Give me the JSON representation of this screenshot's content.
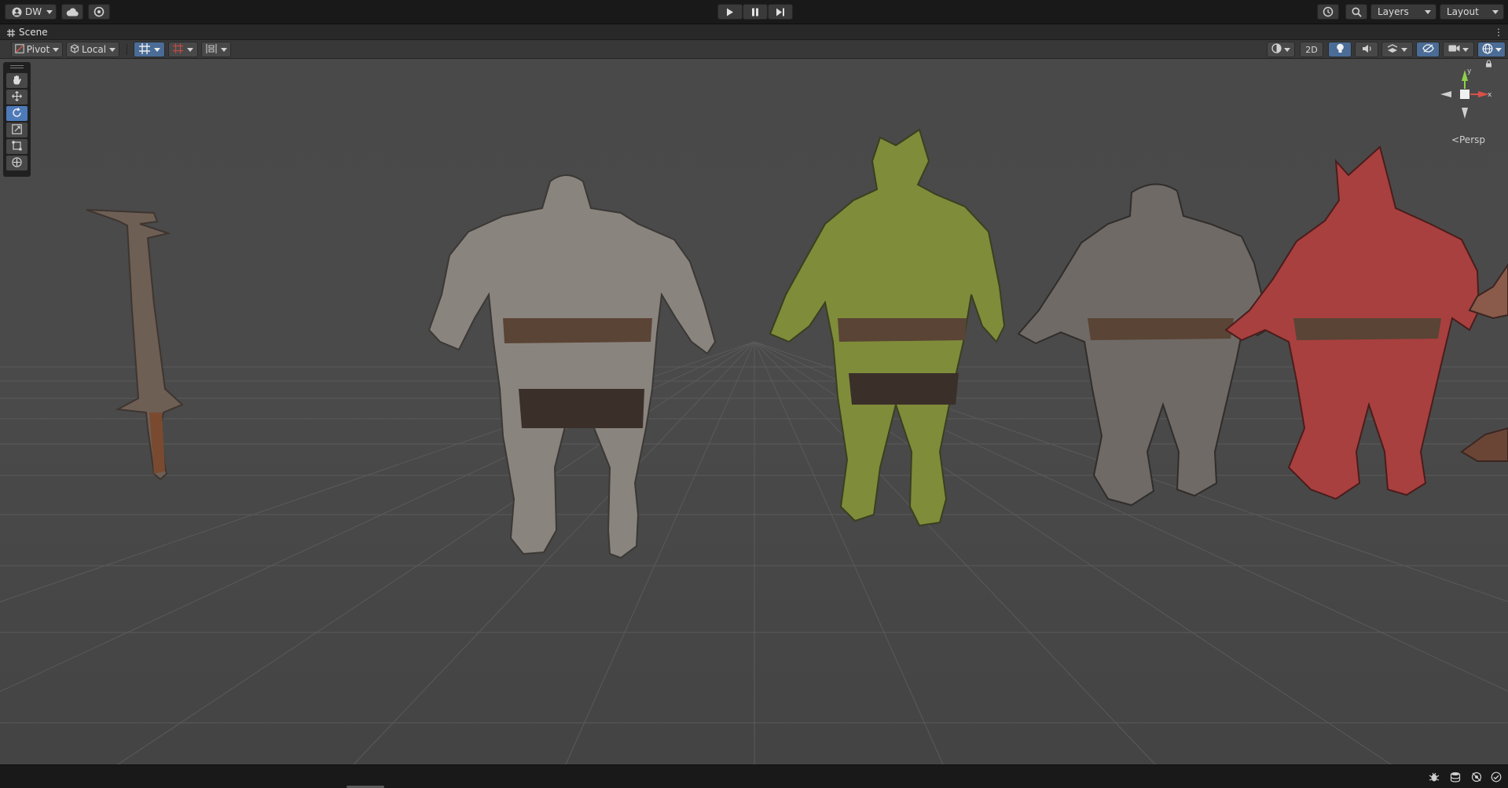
{
  "toolbar": {
    "account_label": "DW",
    "layers_label": "Layers",
    "layout_label": "Layout",
    "icons": [
      "account-icon",
      "cloud-icon",
      "collab-icon",
      "play-icon",
      "pause-icon",
      "step-icon",
      "history-icon",
      "search-icon"
    ]
  },
  "scene_tab": {
    "title": "Scene",
    "menu_glyph": "⋮"
  },
  "scene_toolbar": {
    "pivot_label": "Pivot",
    "local_label": "Local",
    "mode_2d_label": "2D",
    "toggles": {
      "snap": true,
      "lighting": true,
      "gizmos": true,
      "scene_visibility": true
    }
  },
  "tools": [
    {
      "name": "hand-tool",
      "active": false
    },
    {
      "name": "move-tool",
      "active": false
    },
    {
      "name": "rotate-tool",
      "active": true
    },
    {
      "name": "scale-tool",
      "active": false
    },
    {
      "name": "rect-tool",
      "active": false
    },
    {
      "name": "transform-tool",
      "active": false
    }
  ],
  "gizmo": {
    "y_label": "y",
    "x_label": "x",
    "projection_label": "Persp"
  },
  "scene_objects": [
    {
      "name": "weapon-sword",
      "tint": "#6e5f55"
    },
    {
      "name": "armored-character-steel",
      "tint": "#8a847e"
    },
    {
      "name": "armored-character-green",
      "tint": "#7f8c3a"
    },
    {
      "name": "armored-character-iron",
      "tint": "#6f6a66"
    },
    {
      "name": "armored-character-red",
      "tint": "#a8403f"
    },
    {
      "name": "armored-character-partial",
      "tint": "#8a5a4a"
    }
  ],
  "colors": {
    "axis_x": "#d9514a",
    "axis_y": "#8fd14a",
    "accent": "#4d7ab8"
  }
}
